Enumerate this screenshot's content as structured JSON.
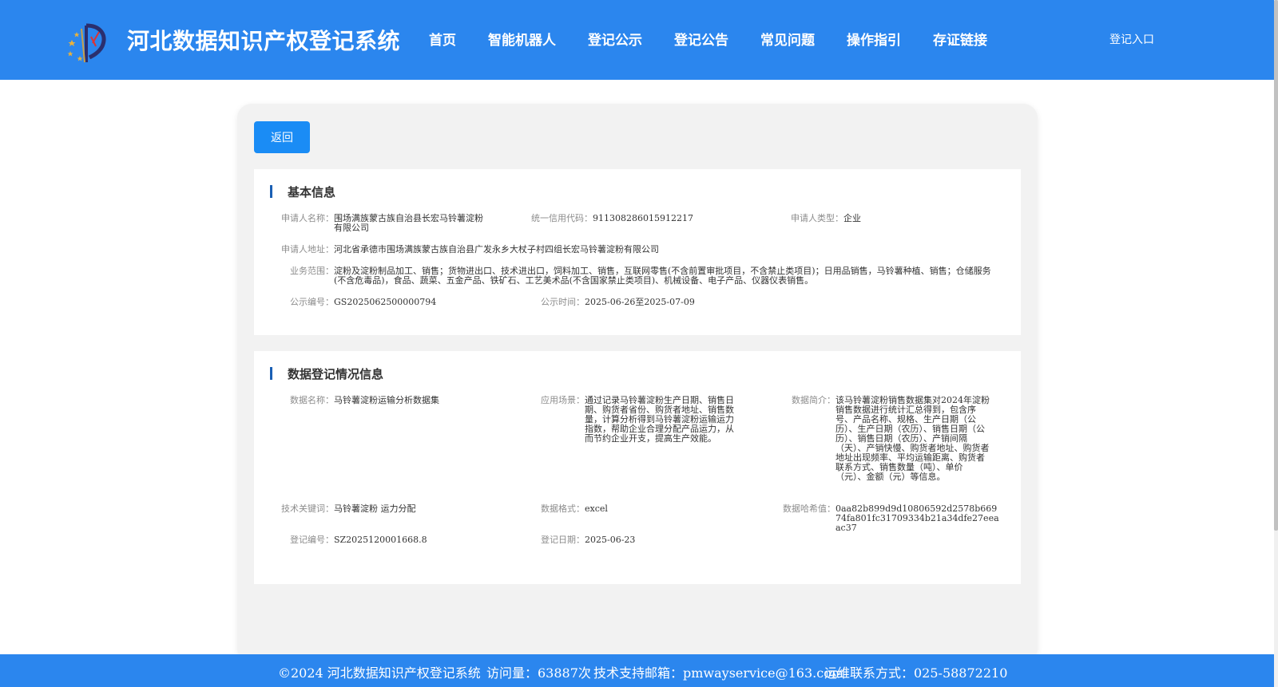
{
  "header": {
    "site_title": "河北数据知识产权登记系统",
    "nav": [
      "首页",
      "智能机器人",
      "登记公示",
      "登记公告",
      "常见问题",
      "操作指引",
      "存证链接"
    ],
    "login": "登记入口"
  },
  "actions": {
    "back": "返回"
  },
  "basic_info": {
    "title": "基本信息",
    "fields": [
      {
        "label": "申请人名称：",
        "value": "围场满族蒙古族自治县长宏马铃薯淀粉有限公司"
      },
      {
        "label": "统一信用代码：",
        "value": "911308286015912217"
      },
      {
        "label": "申请人类型：",
        "value": "企业"
      },
      {
        "label": "申请人地址：",
        "value": "河北省承德市围场满族蒙古族自治县广发永乡大杖子村四组长宏马铃薯淀粉有限公司"
      },
      {
        "label": "业务范围：",
        "value": "淀粉及淀粉制品加工、销售；货物进出口、技术进出口，饲料加工、销售，互联网零售(不含前置审批项目，不含禁止类项目)；日用品销售，马铃薯种植、销售；仓储服务(不含危毒品)，食品、蔬菜、五金产品、铁矿石、工艺美术品(不含国家禁止类项目)、机械设备、电子产品、仪器仪表销售。"
      },
      {
        "label": "公示编号：",
        "value": "GS2025062500000794"
      },
      {
        "label": "公示时间：",
        "value": "2025-06-26至2025-07-09"
      }
    ]
  },
  "data_info": {
    "title": "数据登记情况信息",
    "fields": [
      {
        "label": "数据名称：",
        "value": "马铃薯淀粉运输分析数据集"
      },
      {
        "label": "应用场景：",
        "value": "通过记录马铃薯淀粉生产日期、销售日期、购货者省份、购货者地址、销售数量，计算分析得到马铃薯淀粉运输运力指数，帮助企业合理分配产品运力，从而节约企业开支，提高生产效能。"
      },
      {
        "label": "数据简介：",
        "value": "该马铃薯淀粉销售数据集对2024年淀粉销售数据进行统计汇总得到，包含序号、产品名称、规格、生产日期（公历）、生产日期（农历）、销售日期（公历）、销售日期（农历）、产销间隔（天）、产销快慢、购货者地址、购货者地址出现频率、平均运输距离、购货者联系方式、销售数量（吨）、单价（元）、金额（元）等信息。"
      },
      {
        "label": "技术关键词：",
        "value": "马铃薯淀粉 运力分配"
      },
      {
        "label": "数据格式：",
        "value": "excel"
      },
      {
        "label": "数据哈希值：",
        "value": "0aa82b899d9d10806592d2578b66974fa801fc31709334b21a34dfe27eeaac37"
      },
      {
        "label": "登记编号：",
        "value": "SZ2025120001668.8"
      },
      {
        "label": "登记日期：",
        "value": "2025-06-23"
      }
    ]
  },
  "footer": {
    "copyright": "©2024 河北数据知识产权登记系统",
    "visits": "访问量：63887次",
    "email": "技术支持邮箱：pmwayservice@163.com",
    "phone": "运维联系方式：025-58872210"
  },
  "colors": {
    "header_bg": "#2b86ee",
    "button_bg": "#1a8cf5",
    "section_bar": "#1a5fb4"
  },
  "icons": {
    "logo": "emblem-logo-icon"
  }
}
